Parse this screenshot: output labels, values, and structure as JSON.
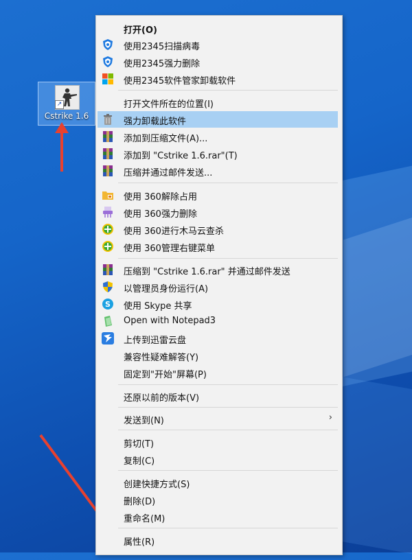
{
  "desktop": {
    "icon_label": "Cstrike 1.6",
    "shortcut_glyph": "↗"
  },
  "menu": {
    "items": [
      {
        "label": "打开(O)",
        "icon": "none",
        "name": "open"
      },
      {
        "label": "使用2345扫描病毒",
        "icon": "shield-2345-icon",
        "name": "scan-virus-2345"
      },
      {
        "label": "使用2345强力删除",
        "icon": "shield-2345-icon",
        "name": "force-delete-2345"
      },
      {
        "label": "使用2345软件管家卸载软件",
        "icon": "windows-tiles-icon",
        "name": "uninstall-2345"
      },
      {
        "label": "打开文件所在的位置(I)",
        "icon": "none",
        "name": "open-file-location"
      },
      {
        "label": "强力卸载此软件",
        "icon": "trash-icon",
        "name": "force-uninstall"
      },
      {
        "label": "添加到压缩文件(A)...",
        "icon": "winrar-icon",
        "name": "add-to-archive"
      },
      {
        "label": "添加到 \"Cstrike 1.6.rar\"(T)",
        "icon": "winrar-icon",
        "name": "add-to-rar"
      },
      {
        "label": "压缩并通过邮件发送...",
        "icon": "winrar-icon",
        "name": "compress-email"
      },
      {
        "label": "使用 360解除占用",
        "icon": "folder-360-icon",
        "name": "unlock-360"
      },
      {
        "label": "使用 360强力删除",
        "icon": "shredder-360-icon",
        "name": "force-delete-360"
      },
      {
        "label": "使用 360进行木马云查杀",
        "icon": "plus-360-icon",
        "name": "trojan-scan-360"
      },
      {
        "label": "使用 360管理右键菜单",
        "icon": "plus-360-icon",
        "name": "manage-menu-360"
      },
      {
        "label": "压缩到 \"Cstrike 1.6.rar\" 并通过邮件发送",
        "icon": "winrar-icon",
        "name": "compress-rar-email"
      },
      {
        "label": "以管理员身份运行(A)",
        "icon": "uac-shield-icon",
        "name": "run-as-admin"
      },
      {
        "label": "使用 Skype 共享",
        "icon": "skype-icon",
        "name": "share-skype"
      },
      {
        "label": "Open with Notepad3",
        "icon": "notepad3-icon",
        "name": "open-notepad3"
      },
      {
        "label": "上传到迅雷云盘",
        "icon": "xunlei-icon",
        "name": "upload-xunlei"
      },
      {
        "label": "兼容性疑难解答(Y)",
        "icon": "none",
        "name": "troubleshoot-compat"
      },
      {
        "label": "固定到\"开始\"屏幕(P)",
        "icon": "none",
        "name": "pin-to-start"
      },
      {
        "label": "还原以前的版本(V)",
        "icon": "none",
        "name": "restore-versions"
      },
      {
        "label": "发送到(N)",
        "icon": "none",
        "name": "send-to",
        "submenu_glyph": "›"
      },
      {
        "label": "剪切(T)",
        "icon": "none",
        "name": "cut"
      },
      {
        "label": "复制(C)",
        "icon": "none",
        "name": "copy"
      },
      {
        "label": "创建快捷方式(S)",
        "icon": "none",
        "name": "create-shortcut"
      },
      {
        "label": "删除(D)",
        "icon": "none",
        "name": "delete"
      },
      {
        "label": "重命名(M)",
        "icon": "none",
        "name": "rename"
      },
      {
        "label": "属性(R)",
        "icon": "none",
        "name": "properties"
      }
    ],
    "highlighted_item": "强力卸载此软件"
  },
  "colors": {
    "highlight": "#a8d0f3",
    "arrow": "#e8412f",
    "desktop": "#1565c9"
  }
}
